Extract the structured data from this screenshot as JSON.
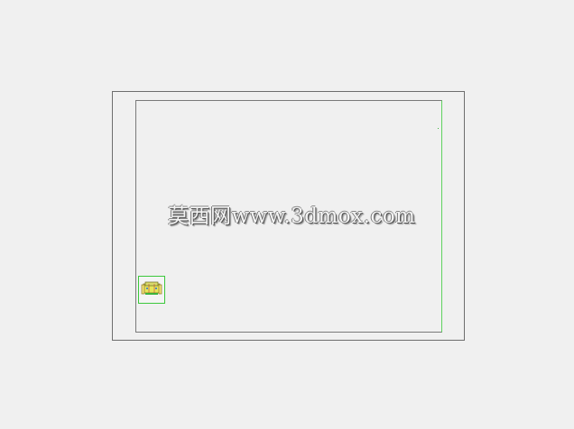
{
  "watermark": {
    "text": "莫西网www.3dmox.com"
  },
  "thumbnail": {
    "icon": "sofa-drawing-icon"
  },
  "colors": {
    "background": "#f0f0f0",
    "frame_line": "#6e6e6e",
    "green_line": "#3cc83c",
    "thumbnail_fill": "#e6e65a"
  }
}
